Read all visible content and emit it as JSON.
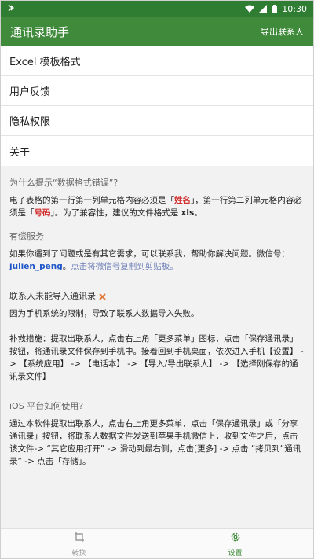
{
  "status_bar": {
    "time": "10:30",
    "colors": {
      "bg": "#2e7d32"
    }
  },
  "app_bar": {
    "title": "通讯录助手",
    "export_label": "导出联系人",
    "color": "#3f8a3b"
  },
  "menu": {
    "items": [
      {
        "label": "Excel 模板格式"
      },
      {
        "label": "用户反馈"
      },
      {
        "label": "隐私权限"
      },
      {
        "label": "关于"
      }
    ]
  },
  "faq": {
    "format_error": {
      "question": "为什么提示“数据格式错误”?",
      "a_part1": "电子表格的第一行第一列单元格内容必须是「",
      "a_name": "姓名",
      "a_part2": "」，第一行第二列单元格内容必须是「",
      "a_number": "号码",
      "a_part3": "」。为了兼容性，建议的文件格式是 ",
      "a_ext": "xls",
      "a_part4": "。"
    },
    "paid_service": {
      "question": "有偿服务",
      "a_part1": "如果你遇到了问题或是有其它需求，可以联系我，帮助你解决问题。微信号：",
      "wechat_id": "julien_peng",
      "a_sep": "。",
      "copy_link": "点击将微信号复制到剪贴板。"
    },
    "import_fail": {
      "question": "联系人未能导入通讯录",
      "a_reason": "因为手机系统的限制，导致了联系人数据导入失败。",
      "a_fix": "补救措施：提取出联系人，点击右上角「更多菜单」图标，点击「保存通讯录」按钮，将通讯录文件保存到手机中。接着回到手机桌面，依次进入手机【设置】 -> 【系统应用】 -> 【电话本】 -> 【导入/导出联系人】 -> 【选择刚保存的通讯录文件】"
    },
    "ios": {
      "question": "iOS 平台如何使用?",
      "answer": "通过本软件提取出联系人，点击右上角更多菜单，点击「保存通讯录」或「分享通讯录」按钮，将联系人数据文件发送到苹果手机微信上，收到文件之后，点击该文件-> “其它应用打开” -> 滑动到最右侧，点击[更多] -> 点击 “拷贝到“通讯录” -> 点击「存储」。"
    }
  },
  "bottom_nav": {
    "items": [
      {
        "label": "转换",
        "active": false
      },
      {
        "label": "设置",
        "active": true
      }
    ],
    "active_color": "#3f8a3b"
  }
}
